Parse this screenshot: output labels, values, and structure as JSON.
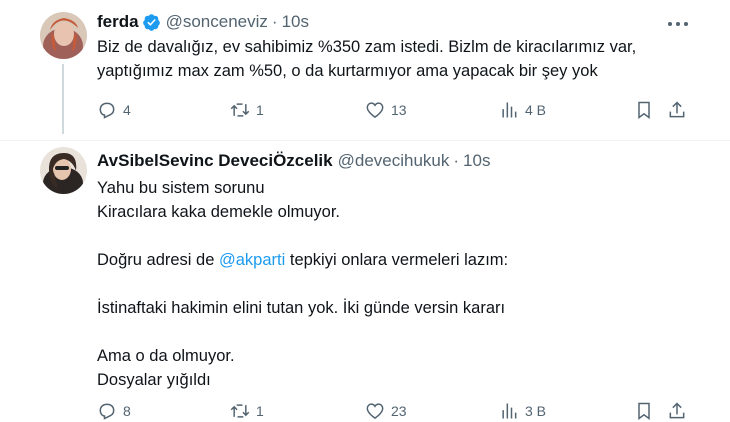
{
  "tweets": [
    {
      "name": "ferda",
      "verified": true,
      "handle": "@sonceneviz",
      "separator": "·",
      "time": "10s",
      "lines": [
        "Biz de davalığız, ev sahibimiz %350 zam istedi. Bizlm de kiracılarımız var,",
        "yaptığımız max zam %50, o da kurtarmıyor ama yapacak bir şey yok"
      ],
      "replies": "4",
      "retweets": "1",
      "likes": "13",
      "views": "4 B"
    },
    {
      "name": "AvSibelSevinc DeveciÖzcelik",
      "handle": "@devecihukuk",
      "separator": "·",
      "time": "10s",
      "line1": "Yahu bu sistem sorunu",
      "line2": "Kiracılara kaka demekle olmuyor.",
      "line3_pre": "Doğru adresi de ",
      "line3_mention": "@akparti",
      "line3_post": " tepkiyi onlara vermeleri lazım:",
      "line4": "İstinaftaki hakimin elini tutan yok. İki günde versin kararı",
      "line5": "Ama o da olmuyor.",
      "line6": "Dosyalar yığıldı",
      "replies": "8",
      "retweets": "1",
      "likes": "23",
      "views": "3 B"
    }
  ],
  "colors": {
    "text": "#0f1419",
    "secondary": "#536471",
    "accent": "#1d9bf0",
    "divider": "#eff3f4"
  },
  "icons": [
    "verified-badge-icon",
    "more-icon",
    "reply-icon",
    "retweet-icon",
    "like-icon",
    "views-icon",
    "bookmark-icon",
    "share-icon"
  ]
}
